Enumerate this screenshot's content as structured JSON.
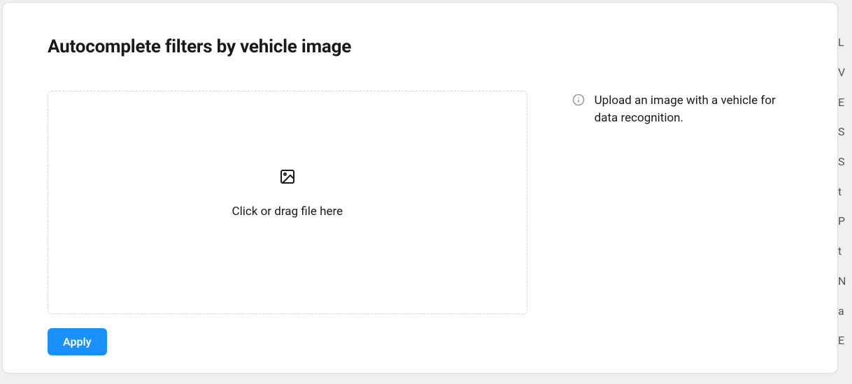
{
  "modal": {
    "title": "Autocomplete filters by vehicle image",
    "dropzone": {
      "prompt": "Click or drag file here"
    },
    "info": {
      "text": "Upload an image with a vehicle for data recognition."
    },
    "apply_label": "Apply"
  },
  "background_fragments": [
    "L",
    "V",
    "E",
    "S",
    "S",
    "t",
    "P",
    "t",
    "N",
    "a",
    "E"
  ]
}
